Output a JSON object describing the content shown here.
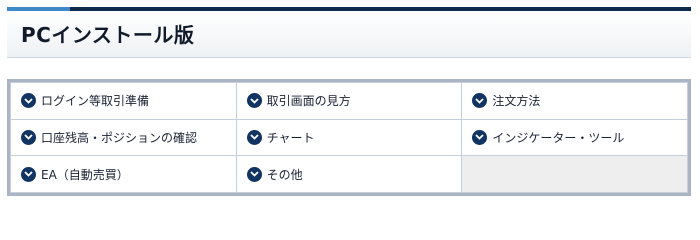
{
  "header": {
    "title": "PCインストール版"
  },
  "menu": {
    "rows": [
      [
        {
          "label": "ログイン等取引準備"
        },
        {
          "label": "取引画面の見方"
        },
        {
          "label": "注文方法"
        }
      ],
      [
        {
          "label": "口座残高・ポジションの確認"
        },
        {
          "label": "チャート"
        },
        {
          "label": "インジケーター・ツール"
        }
      ],
      [
        {
          "label": "EA（自動売買）"
        },
        {
          "label": "その他"
        }
      ]
    ]
  },
  "colors": {
    "accent_blue": "#3d89c8",
    "navy": "#0f2a4a",
    "icon": "#123462",
    "panel_border": "#a9b4c5"
  },
  "icons": {
    "item_icon": "chevron-down-circle-icon"
  }
}
